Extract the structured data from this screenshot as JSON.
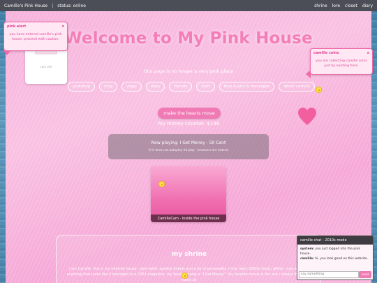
{
  "topbar": {
    "site_title": "Camille's Pink House",
    "separator": "|",
    "status": "status: online",
    "nav": [
      "shrine",
      "lore",
      "closet",
      "diary"
    ]
  },
  "main": {
    "heading": "Welcome to My Pink House",
    "tagline": "this page is no longer a very pink place",
    "chips": [
      "pinkshop",
      "blog",
      "vlogs",
      "diary",
      "friends",
      "stuff",
      "fans & pics & messages",
      "about camille"
    ],
    "hearts_button": "make the hearts move",
    "money_counter": "my money counter: $146"
  },
  "now_playing": {
    "title": "Now playing: I Get Money - 50 Cent",
    "note": "(if it does not autoplay hit play - browsers are haters)"
  },
  "cam": {
    "caption": "CamilleCam - inside the pink house"
  },
  "shrine": {
    "title": "my shrine",
    "text": "i am Camille. this is my internet house - pink walls, sparkly details and a lot of personality. i love hairy 2000s music, glitter, cute animals, anything that looks like it belonged to a 2003 magazine. my favorite song is \"I Get Money\". my favorite movie is the one i always forget the name of."
  },
  "profile": {
    "label": "cam site"
  },
  "alert_popup": {
    "title": "pink alert",
    "close": "x",
    "body": "you have entered camille's pink house. proceed with caution."
  },
  "coins_popup": {
    "title": "camille coins",
    "close": "x",
    "body": "you are collecting camille coins just by existing here."
  },
  "chat": {
    "header": "camille chat - 2010s mode",
    "messages": [
      {
        "who": "system:",
        "text": "you just logged into the pink house."
      },
      {
        "who": "camille:",
        "text": "hi, you look good on this website."
      }
    ],
    "input_placeholder": "say something",
    "send_label": "send"
  },
  "colors": {
    "accent_pink": "#f07ab4",
    "heading_pink": "#f47fb8",
    "heart_pink": "#f25f9f",
    "topbar": "#4b4e56"
  },
  "icons": {
    "heart": "heart-icon",
    "coin": "coin-icon",
    "close": "close-icon"
  }
}
